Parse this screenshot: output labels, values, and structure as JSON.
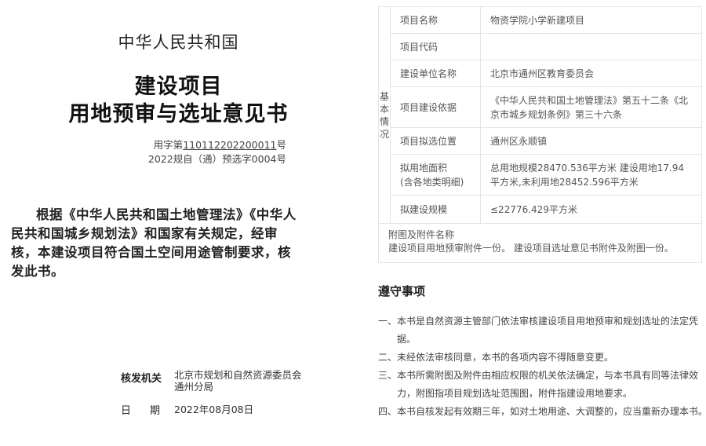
{
  "cert": {
    "country": "中华人民共和国",
    "title_line1": "建设项目",
    "title_line2": "用地预审与选址意见书",
    "doc_no_prefix": "用字第",
    "doc_no_number": "110112202200011",
    "doc_no_suffix": "号",
    "doc_no2": "2022规自（通）预选字0004号",
    "body": "根据《中华人民共和国土地管理法》《中华人民共和国城乡规划法》和国家有关规定，经审核，本建设项目符合国土空间用途管制要求，核发此书。",
    "issuer_label": "核发机关",
    "issuer_value_line1": "北京市规划和自然资源委员会",
    "issuer_value_line2": "通州分局",
    "date_label_1": "日",
    "date_label_2": "期",
    "date_value": "2022年08月08日"
  },
  "table": {
    "section_label": "基本情况",
    "rows": [
      {
        "key": "项目名称",
        "value": "物资学院小学新建项目"
      },
      {
        "key": "项目代码",
        "value": ""
      },
      {
        "key": "建设单位名称",
        "value": "北京市通州区教育委员会"
      },
      {
        "key": "项目建设依据",
        "value": "《中华人民共和国土地管理法》第五十二条《北京市城乡规划条例》第三十六条"
      },
      {
        "key": "项目拟选位置",
        "value": "通州区永顺镇"
      },
      {
        "key": "拟用地面积\n(含各地类明细)",
        "value": "总用地规模28470.536平方米 建设用地17.94平方米,未利用地28452.596平方米"
      },
      {
        "key": "拟建设规模",
        "value": "≤22776.429平方米"
      }
    ]
  },
  "attachments": {
    "label": "附图及附件名称",
    "value": "建设项目用地预审附件一份。 建设项目选址意见书附件及附图一份。"
  },
  "notices": {
    "title": "遵守事项",
    "items": [
      {
        "num": "一、",
        "text": "本书是自然资源主管部门依法审核建设项目用地预审和规划选址的法定凭据。"
      },
      {
        "num": "二、",
        "text": "未经依法审核同意，本书的各项内容不得随意变更。"
      },
      {
        "num": "三、",
        "text": "本书所需附图及附件由相应权限的机关依法确定，与本书具有同等法律效力，附图指项目规划选址范围图，附件指建设用地要求。"
      },
      {
        "num": "四、",
        "text": "本书自核发起有效期三年，如对土地用途、大调整的，应当重新办理本书。"
      }
    ]
  }
}
